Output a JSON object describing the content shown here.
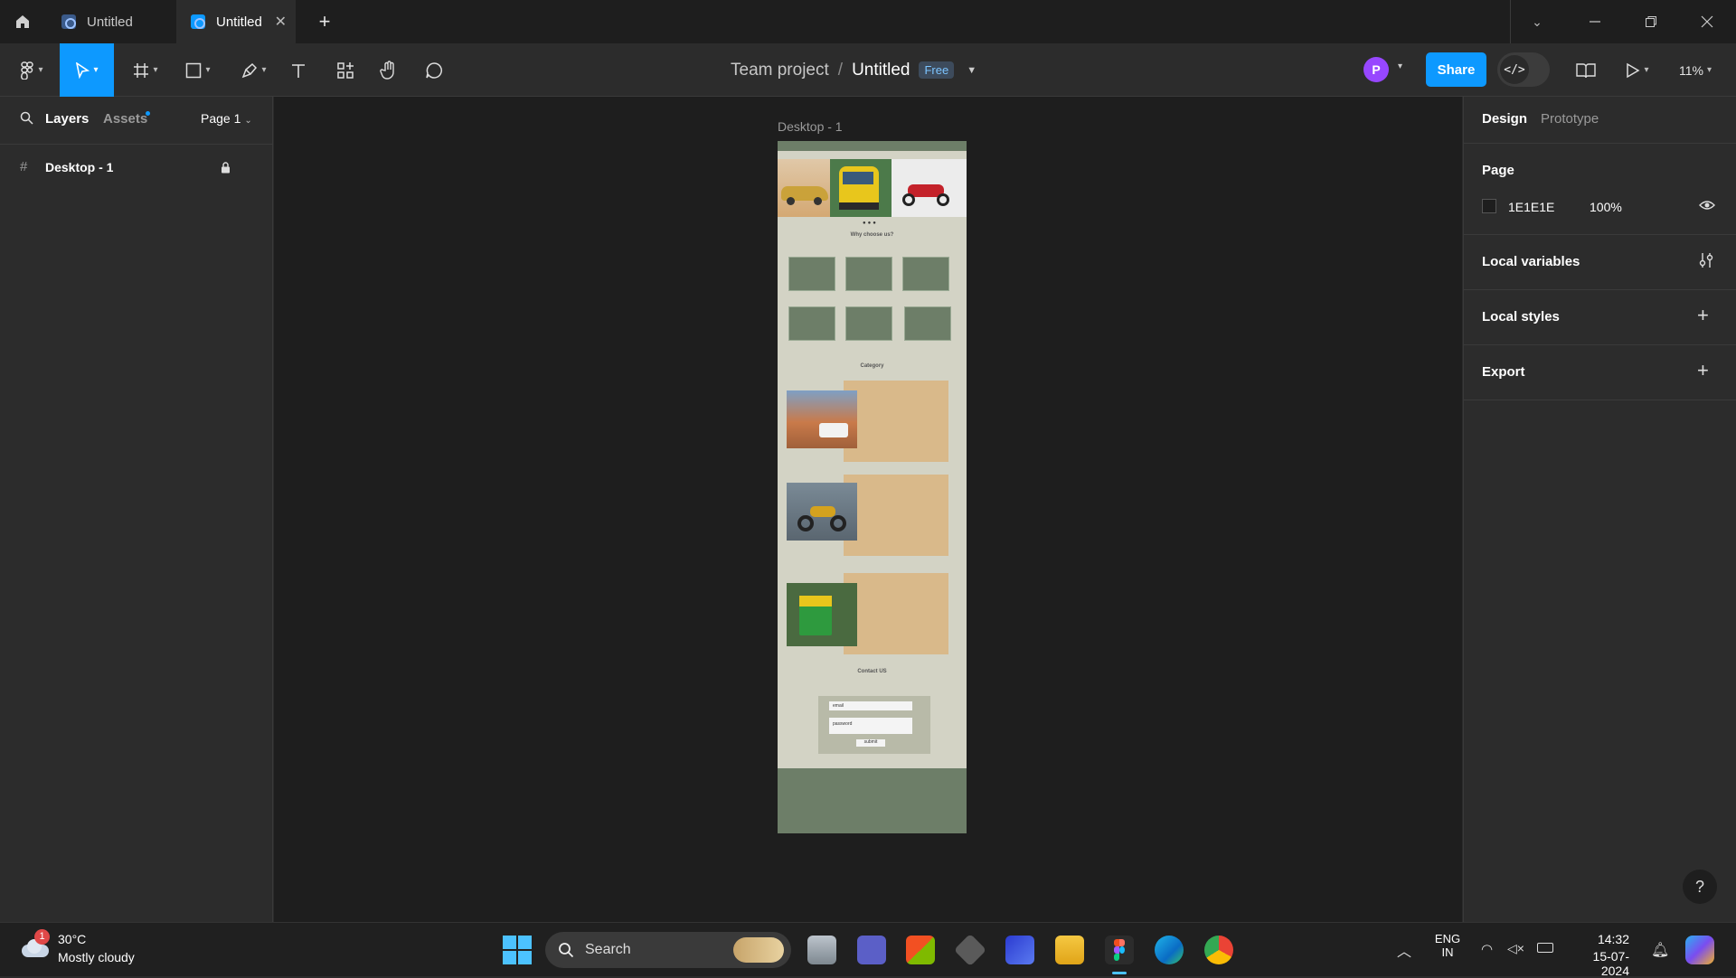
{
  "tabs": [
    {
      "label": "Untitled"
    },
    {
      "label": "Untitled"
    }
  ],
  "toolbar": {
    "breadcrumb_team": "Team project",
    "breadcrumb_sep": "/",
    "file_name": "Untitled",
    "plan_badge": "Free",
    "avatar_initial": "P",
    "share_label": "Share",
    "zoom": "11%"
  },
  "left_panel": {
    "tab_layers": "Layers",
    "tab_assets": "Assets",
    "page_selector": "Page 1",
    "layers": [
      {
        "name": "Desktop - 1",
        "locked": true
      }
    ]
  },
  "right_panel": {
    "tab_design": "Design",
    "tab_prototype": "Prototype",
    "page_section": "Page",
    "page_color_hex": "1E1E1E",
    "page_opacity": "100%",
    "local_variables": "Local variables",
    "local_styles": "Local styles",
    "export": "Export",
    "help": "?"
  },
  "canvas": {
    "frame_label": "Desktop - 1",
    "design": {
      "why_title": "Why choose us?",
      "category_title": "Category",
      "contact_title": "Contact US",
      "form_email": "email",
      "form_password": "password",
      "form_submit": "submit"
    }
  },
  "taskbar": {
    "weather_temp": "30°C",
    "weather_desc": "Mostly cloudy",
    "weather_badge": "1",
    "search_placeholder": "Search",
    "lang_top": "ENG",
    "lang_bottom": "IN",
    "time": "14:32",
    "date": "15-07-2024"
  },
  "colors": {
    "accent": "#0d99ff",
    "avatar": "#9747ff",
    "frame_bg": "#d3d3c5",
    "frame_green": "#6d7e68",
    "card_tan": "#d9b98a"
  }
}
